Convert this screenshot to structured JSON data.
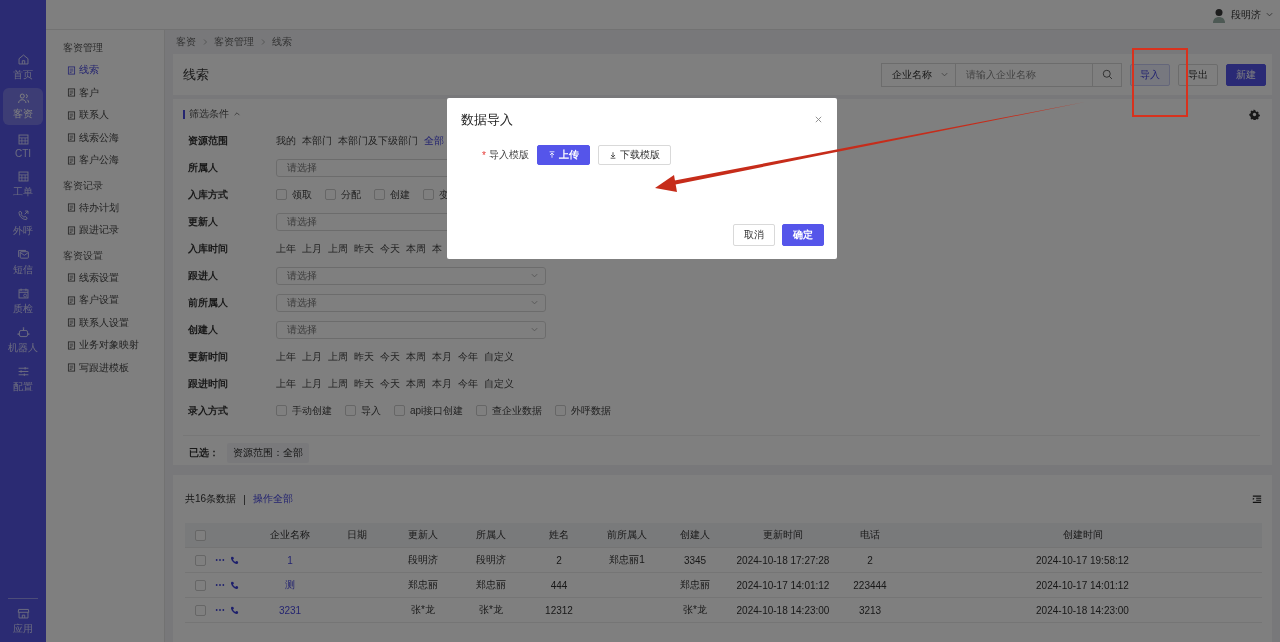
{
  "top_bar": {
    "user": "段明济"
  },
  "nav_rail": {
    "items": [
      {
        "label": "首页",
        "selected": false
      },
      {
        "label": "客资",
        "selected": true
      },
      {
        "label": "CTI",
        "selected": false
      },
      {
        "label": "工单",
        "selected": false
      },
      {
        "label": "外呼",
        "selected": false
      },
      {
        "label": "短信",
        "selected": false
      },
      {
        "label": "质检",
        "selected": false
      },
      {
        "label": "机器人",
        "selected": false
      },
      {
        "label": "配置",
        "selected": false
      }
    ],
    "bottom_item": {
      "label": "应用",
      "selected": false
    }
  },
  "sidebar": {
    "groups": [
      {
        "title": "客资管理",
        "items": [
          {
            "label": "线索",
            "selected": true
          },
          {
            "label": "客户",
            "selected": false
          },
          {
            "label": "联系人",
            "selected": false
          },
          {
            "label": "线索公海",
            "selected": false
          },
          {
            "label": "客户公海",
            "selected": false
          }
        ]
      },
      {
        "title": "客资记录",
        "items": [
          {
            "label": "待办计划",
            "selected": false
          },
          {
            "label": "跟进记录",
            "selected": false
          }
        ]
      },
      {
        "title": "客资设置",
        "items": [
          {
            "label": "线索设置",
            "selected": false
          },
          {
            "label": "客户设置",
            "selected": false
          },
          {
            "label": "联系人设置",
            "selected": false
          },
          {
            "label": "业务对象映射",
            "selected": false
          },
          {
            "label": "写跟进模板",
            "selected": false
          }
        ]
      }
    ]
  },
  "breadcrumb": [
    "客资",
    "客资管理",
    "线索"
  ],
  "header": {
    "title": "线索",
    "search": {
      "field": "企业名称",
      "placeholder": "请输入企业名称"
    },
    "buttons": [
      {
        "label": "导入",
        "kind": "highlighted"
      },
      {
        "label": "导出",
        "kind": "default"
      },
      {
        "label": "新建",
        "kind": "primary"
      }
    ]
  },
  "filters": {
    "title": "筛选条件",
    "expanded": true,
    "rows": [
      {
        "label": "资源范围",
        "kind": "options",
        "options": [
          {
            "label": "我的",
            "selected": false
          },
          {
            "label": "本部门",
            "selected": false
          },
          {
            "label": "本部门及下级部门",
            "selected": false
          },
          {
            "label": "全部",
            "selected": true
          }
        ]
      },
      {
        "label": "所属人",
        "kind": "select",
        "placeholder": "请选择"
      },
      {
        "label": "入库方式",
        "kind": "checkboxes",
        "options": [
          {
            "label": "领取",
            "checked": false
          },
          {
            "label": "分配",
            "checked": false
          },
          {
            "label": "创建",
            "checked": false
          },
          {
            "label": "变",
            "checked": false
          }
        ]
      },
      {
        "label": "更新人",
        "kind": "select",
        "placeholder": "请选择"
      },
      {
        "label": "入库时间",
        "kind": "options",
        "options": [
          {
            "label": "上年",
            "selected": false
          },
          {
            "label": "上月",
            "selected": false
          },
          {
            "label": "上周",
            "selected": false
          },
          {
            "label": "昨天",
            "selected": false
          },
          {
            "label": "今天",
            "selected": false
          },
          {
            "label": "本周",
            "selected": false
          },
          {
            "label": "本",
            "selected": false
          }
        ]
      },
      {
        "label": "跟进人",
        "kind": "select",
        "placeholder": "请选择"
      },
      {
        "label": "前所属人",
        "kind": "select",
        "placeholder": "请选择"
      },
      {
        "label": "创建人",
        "kind": "select",
        "placeholder": "请选择"
      },
      {
        "label": "更新时间",
        "kind": "options",
        "options": [
          {
            "label": "上年",
            "selected": false
          },
          {
            "label": "上月",
            "selected": false
          },
          {
            "label": "上周",
            "selected": false
          },
          {
            "label": "昨天",
            "selected": false
          },
          {
            "label": "今天",
            "selected": false
          },
          {
            "label": "本周",
            "selected": false
          },
          {
            "label": "本月",
            "selected": false
          },
          {
            "label": "今年",
            "selected": false
          },
          {
            "label": "自定义",
            "selected": false
          }
        ]
      },
      {
        "label": "跟进时间",
        "kind": "options",
        "options": [
          {
            "label": "上年",
            "selected": false
          },
          {
            "label": "上月",
            "selected": false
          },
          {
            "label": "上周",
            "selected": false
          },
          {
            "label": "昨天",
            "selected": false
          },
          {
            "label": "今天",
            "selected": false
          },
          {
            "label": "本周",
            "selected": false
          },
          {
            "label": "本月",
            "selected": false
          },
          {
            "label": "今年",
            "selected": false
          },
          {
            "label": "自定义",
            "selected": false
          }
        ]
      },
      {
        "label": "录入方式",
        "kind": "checkboxes",
        "options": [
          {
            "label": "手动创建",
            "checked": false
          },
          {
            "label": "导入",
            "checked": false
          },
          {
            "label": "api接口创建",
            "checked": false
          },
          {
            "label": "查企业数据",
            "checked": false
          },
          {
            "label": "外呼数据",
            "checked": false
          }
        ]
      }
    ],
    "selected_label": "已选：",
    "selected_tags": [
      "资源范围：全部"
    ]
  },
  "table": {
    "count_text": "共16条数据",
    "separator": "|",
    "bulk_link": "操作全部",
    "all_checked": false,
    "columns": [
      "企业名称",
      "日期",
      "更新人",
      "所属人",
      "姓名",
      "前所属人",
      "创建人",
      "更新时间",
      "电话",
      "创建时间"
    ],
    "rows": [
      {
        "checked": false,
        "cells": [
          "1",
          null,
          "段明济",
          "段明济",
          "2",
          "郑忠丽1",
          "3345",
          "2024-10-18 17:27:28",
          "2",
          "2024-10-17 19:58:12"
        ]
      },
      {
        "checked": false,
        "cells": [
          "测",
          null,
          "郑忠丽",
          "郑忠丽",
          "444",
          null,
          "郑忠丽",
          "2024-10-17 14:01:12",
          "223444",
          "2024-10-17 14:01:12"
        ]
      },
      {
        "checked": false,
        "cells": [
          "3231",
          null,
          "张*龙",
          "张*龙",
          "12312",
          null,
          "张*龙",
          "2024-10-18 14:23:00",
          "3213",
          "2024-10-18 14:23:00"
        ]
      }
    ]
  },
  "modal": {
    "title": "数据导入",
    "field": {
      "required_mark": "*",
      "label": "导入模版"
    },
    "upload_button": "上传",
    "download_button": "下载模版",
    "buttons": [
      {
        "label": "取消",
        "kind": "default"
      },
      {
        "label": "确定",
        "kind": "primary"
      }
    ]
  },
  "annotations": [
    {
      "kind": "box",
      "color": "#d8321e"
    },
    {
      "kind": "arrow",
      "color": "#c62c1a"
    }
  ]
}
